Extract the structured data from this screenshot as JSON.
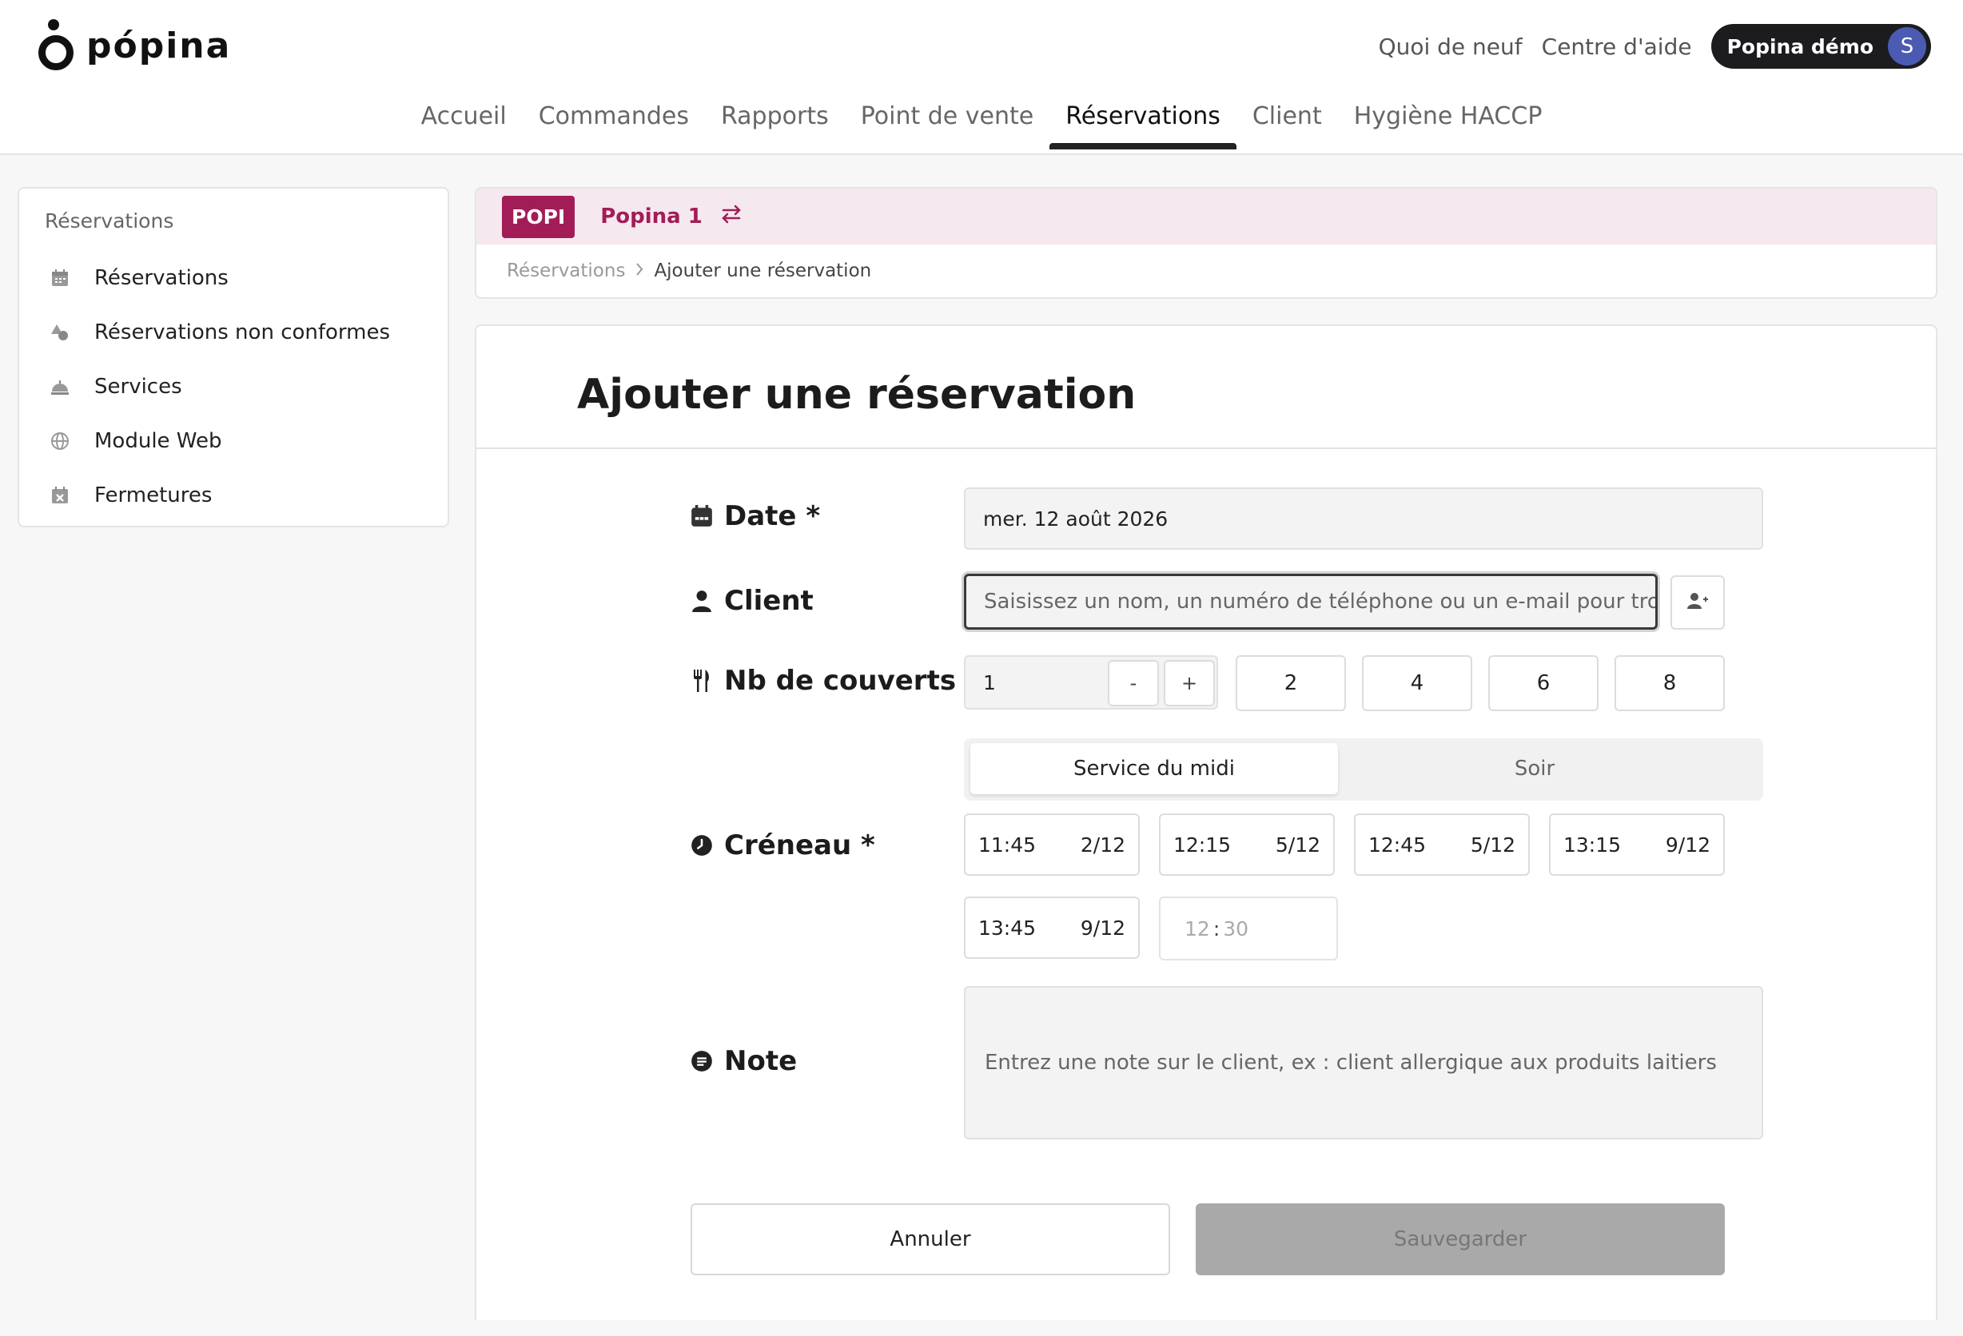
{
  "brand": {
    "name": "pópina"
  },
  "top_links": {
    "whats_new": "Quoi de neuf",
    "help_center": "Centre d'aide",
    "account_label": "Popina démo",
    "avatar_initial": "S"
  },
  "main_nav": [
    "Accueil",
    "Commandes",
    "Rapports",
    "Point de vente",
    "Réservations",
    "Client",
    "Hygiène HACCP"
  ],
  "main_nav_active": "Réservations",
  "sidebar": {
    "title": "Réservations",
    "items": [
      {
        "label": "Réservations",
        "icon": "calendar-icon"
      },
      {
        "label": "Réservations non conformes",
        "icon": "shapes-icon"
      },
      {
        "label": "Services",
        "icon": "service-bell-icon"
      },
      {
        "label": "Module Web",
        "icon": "globe-icon"
      },
      {
        "label": "Fermetures",
        "icon": "calendar-x-icon"
      }
    ]
  },
  "venue": {
    "badge": "POPI",
    "name": "Popina 1"
  },
  "breadcrumb": {
    "parent": "Réservations",
    "current": "Ajouter une réservation"
  },
  "form": {
    "title": "Ajouter une réservation",
    "date_label": "Date *",
    "date_value": "mer. 12 août 2026",
    "client_label": "Client",
    "client_placeholder": "Saisissez un nom, un numéro de téléphone ou un e-mail pour trouve",
    "couverts_label": "Nb de couverts *",
    "couverts_value": "1",
    "stepper_minus": "-",
    "stepper_plus": "+",
    "quick_couverts": [
      "2",
      "4",
      "6",
      "8"
    ],
    "services": [
      "Service du midi",
      "Soir"
    ],
    "active_service": "Service du midi",
    "creneau_label": "Créneau *",
    "slots": [
      {
        "time": "11:45",
        "occupancy": "2/12"
      },
      {
        "time": "12:15",
        "occupancy": "5/12"
      },
      {
        "time": "12:45",
        "occupancy": "5/12"
      },
      {
        "time": "13:15",
        "occupancy": "9/12"
      },
      {
        "time": "13:45",
        "occupancy": "9/12"
      }
    ],
    "custom_time": {
      "hours": "12",
      "separator": ":",
      "minutes": "30"
    },
    "note_label": "Note",
    "note_placeholder": "Entrez une note sur le client, ex : client allergique aux produits laitiers",
    "cancel_label": "Annuler",
    "save_label": "Sauvegarder"
  },
  "colors": {
    "brand_accent": "#a21d57",
    "venue_background": "#f5e8ee",
    "account_pill": "#1c1c1f",
    "avatar": "#4b5bb3",
    "save_disabled": "#a9a9a9"
  }
}
